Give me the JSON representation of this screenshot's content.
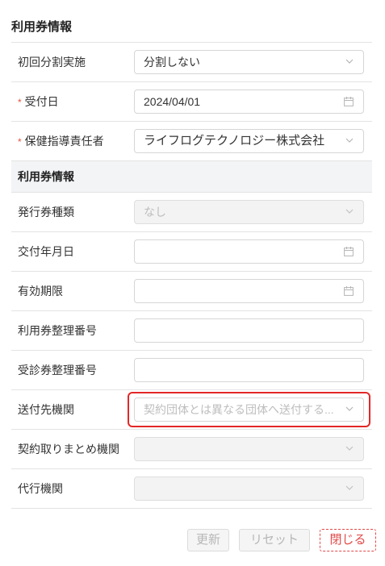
{
  "header": {
    "title": "利用券情報"
  },
  "form": {
    "split": {
      "label": "初回分割実施",
      "value": "分割しない"
    },
    "received_date": {
      "required_mark": "*",
      "label": "受付日",
      "value": "2024/04/01"
    },
    "guidance_person": {
      "required_mark": "*",
      "label": "保健指導責任者",
      "value": "ライフログテクノロジー株式会社"
    },
    "section": {
      "label": "利用券情報"
    },
    "ticket_type": {
      "label": "発行券種類",
      "value": "なし"
    },
    "issue_date": {
      "label": "交付年月日",
      "value": ""
    },
    "expiry": {
      "label": "有効期限",
      "value": ""
    },
    "ticket_number": {
      "label": "利用券整理番号",
      "value": ""
    },
    "consult_number": {
      "label": "受診券整理番号",
      "value": ""
    },
    "send_to": {
      "label": "送付先機関",
      "placeholder": "契約団体とは異なる団体へ送付する..."
    },
    "contract_agg": {
      "label": "契約取りまとめ機関",
      "value": ""
    },
    "agency": {
      "label": "代行機関",
      "value": ""
    }
  },
  "footer": {
    "update": "更新",
    "reset": "リセット",
    "close": "閉じる"
  }
}
